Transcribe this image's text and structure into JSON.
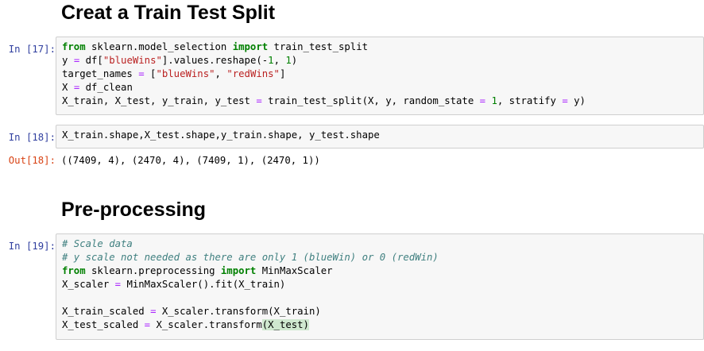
{
  "headings": {
    "split": "Creat a Train Test Split",
    "preprocessing": "Pre-processing"
  },
  "cells": [
    {
      "prompt": "In [17]:",
      "lines": [
        [
          [
            "kw",
            "from"
          ],
          [
            "t",
            " sklearn.model_selection "
          ],
          [
            "kw",
            "import"
          ],
          [
            "t",
            " train_test_split"
          ]
        ],
        [
          [
            "t",
            "y "
          ],
          [
            "op",
            "="
          ],
          [
            "t",
            " df["
          ],
          [
            "str",
            "\"blueWins\""
          ],
          [
            "t",
            "].values.reshape(-"
          ],
          [
            "num",
            "1"
          ],
          [
            "t",
            ", "
          ],
          [
            "num",
            "1"
          ],
          [
            "t",
            ")"
          ]
        ],
        [
          [
            "t",
            "target_names "
          ],
          [
            "op",
            "="
          ],
          [
            "t",
            " ["
          ],
          [
            "str",
            "\"blueWins\""
          ],
          [
            "t",
            ", "
          ],
          [
            "str",
            "\"redWins\""
          ],
          [
            "t",
            "]"
          ]
        ],
        [
          [
            "t",
            "X "
          ],
          [
            "op",
            "="
          ],
          [
            "t",
            " df_clean"
          ]
        ],
        [
          [
            "t",
            "X_train, X_test, y_train, y_test "
          ],
          [
            "op",
            "="
          ],
          [
            "t",
            " train_test_split(X, y, random_state "
          ],
          [
            "op",
            "="
          ],
          [
            "t",
            " "
          ],
          [
            "num",
            "1"
          ],
          [
            "t",
            ", stratify "
          ],
          [
            "op",
            "="
          ],
          [
            "t",
            " y)"
          ]
        ]
      ]
    },
    {
      "prompt": "In [18]:",
      "lines": [
        [
          [
            "t",
            "X_train.shape,X_test.shape,y_train.shape, y_test.shape"
          ]
        ]
      ]
    },
    {
      "prompt": "In [19]:",
      "lines": [
        [
          [
            "cm",
            "# Scale data"
          ]
        ],
        [
          [
            "cm",
            "# y scale not needed as there are only 1 (blueWin) or 0 (redWin)"
          ]
        ],
        [
          [
            "kw",
            "from"
          ],
          [
            "t",
            " sklearn.preprocessing "
          ],
          [
            "kw",
            "import"
          ],
          [
            "t",
            " MinMaxScaler"
          ]
        ],
        [
          [
            "t",
            "X_scaler "
          ],
          [
            "op",
            "="
          ],
          [
            "t",
            " MinMaxScaler().fit(X_train)"
          ]
        ],
        [
          [
            "t",
            ""
          ]
        ],
        [
          [
            "t",
            "X_train_scaled "
          ],
          [
            "op",
            "="
          ],
          [
            "t",
            " X_scaler.transform(X_train)"
          ]
        ],
        [
          [
            "t",
            "X_test_scaled "
          ],
          [
            "op",
            "="
          ],
          [
            "t",
            " X_scaler.transform"
          ],
          [
            "m",
            "(X_test)"
          ]
        ]
      ]
    }
  ],
  "outputs": [
    {
      "prompt": "Out[18]:",
      "text": "((7409, 4), (2470, 4), (7409, 1), (2470, 1))"
    }
  ],
  "colors": {
    "prompt_in": "#303f9f",
    "prompt_out": "#d84315",
    "keyword": "#008000",
    "string": "#ba2121",
    "operator": "#aa22ff",
    "comment": "#408080",
    "cell_background": "#f7f7f7",
    "cell_border": "#cfcfcf"
  }
}
